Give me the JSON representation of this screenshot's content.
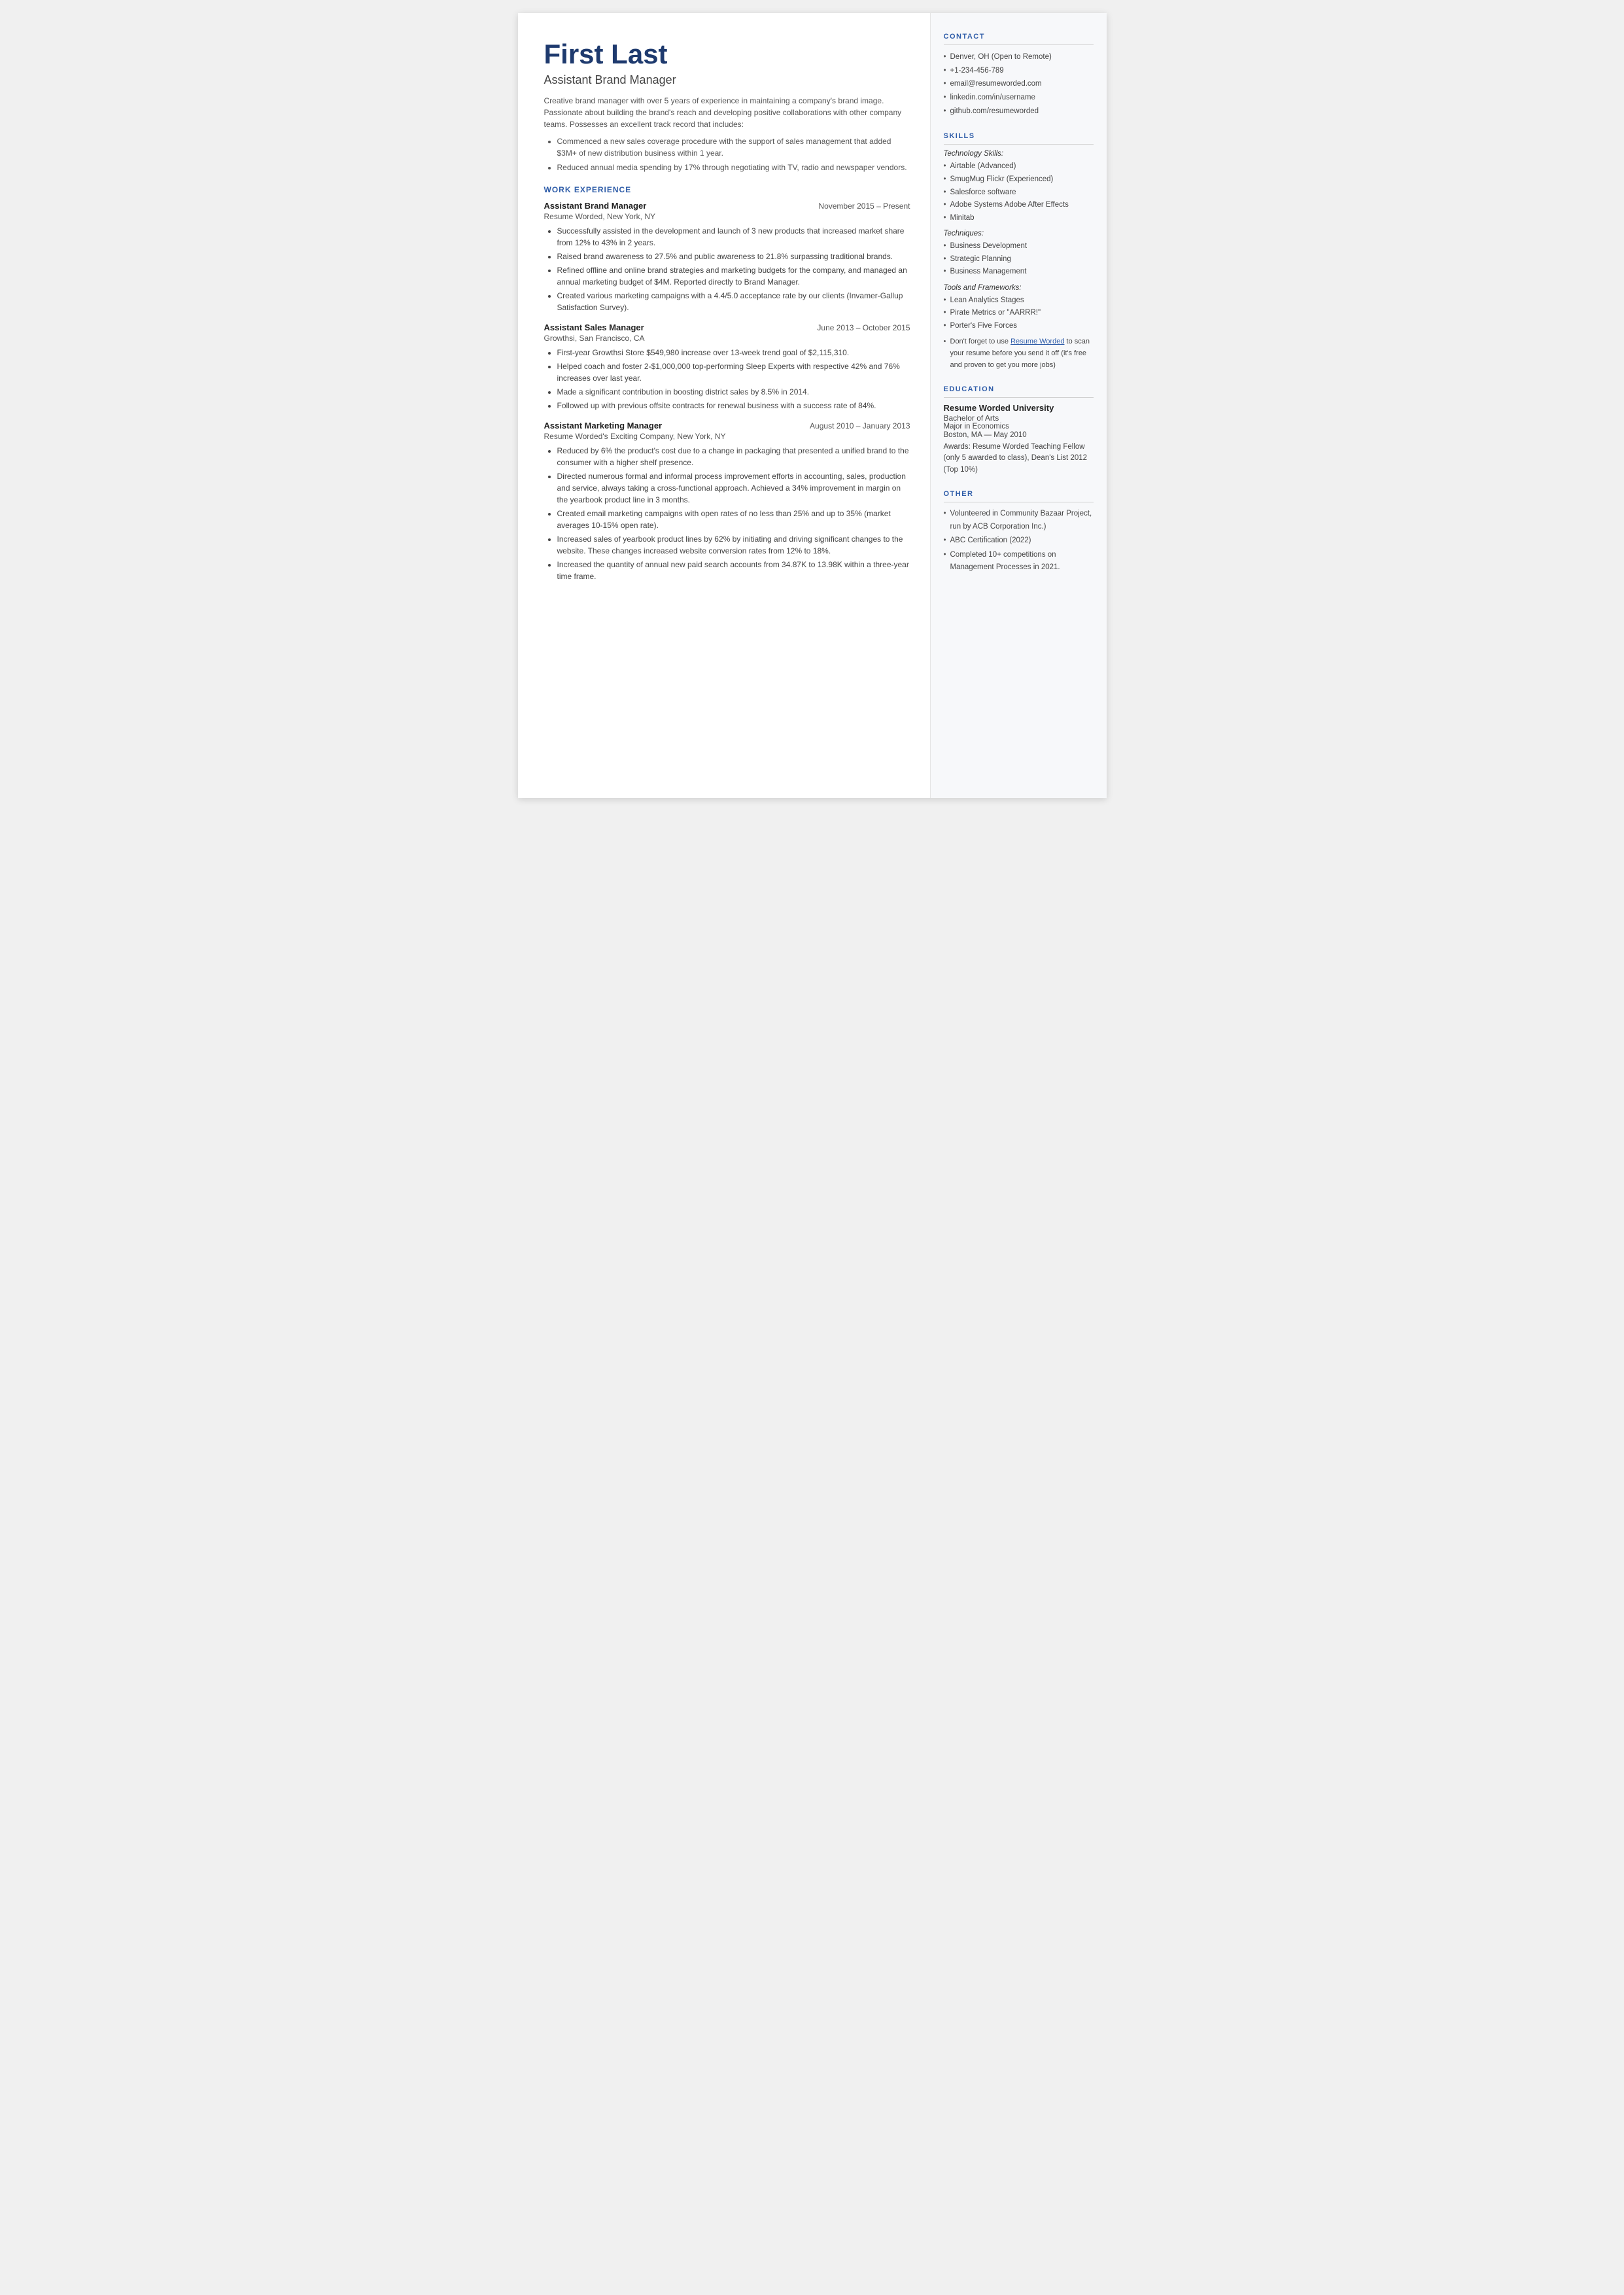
{
  "name": "First Last",
  "job_title": "Assistant Brand Manager",
  "summary": "Creative brand manager with over 5 years of experience in maintaining a company's brand image. Passionate about building the brand's reach and developing positive collaborations with other company teams. Possesses an excellent track record that includes:",
  "summary_bullets": [
    "Commenced a new sales coverage procedure with the support of sales management that added $3M+ of new distribution business within 1 year.",
    "Reduced annual media spending by 17% through negotiating with TV, radio and newspaper vendors."
  ],
  "sections": {
    "work_experience_label": "WORK EXPERIENCE",
    "jobs": [
      {
        "title": "Assistant Brand Manager",
        "dates": "November 2015 – Present",
        "company": "Resume Worded, New York, NY",
        "bullets": [
          "Successfully assisted in the development and launch of 3 new products that increased market share from 12% to 43% in 2 years.",
          "Raised brand awareness to 27.5% and public awareness to 21.8% surpassing traditional brands.",
          "Refined offline and online brand strategies and marketing budgets for the company, and managed an annual marketing budget of $4M. Reported directly to Brand Manager.",
          "Created various marketing campaigns with a 4.4/5.0 acceptance rate by our clients (Invamer-Gallup Satisfaction Survey)."
        ]
      },
      {
        "title": "Assistant Sales Manager",
        "dates": "June 2013 – October 2015",
        "company": "Growthsi, San Francisco, CA",
        "bullets": [
          "First-year Growthsi Store $549,980 increase over 13-week trend goal of $2,115,310.",
          "Helped coach and foster 2-$1,000,000 top-performing Sleep Experts with respective 42% and 76% increases over last year.",
          "Made a significant contribution in boosting district sales by 8.5% in 2014.",
          "Followed up with previous offsite contracts for renewal business with a success rate of 84%."
        ]
      },
      {
        "title": "Assistant Marketing Manager",
        "dates": "August 2010 – January 2013",
        "company": "Resume Worded's Exciting Company, New York, NY",
        "bullets": [
          "Reduced by 6% the product's cost due to a change in packaging that presented a unified brand to the consumer with a higher shelf presence.",
          "Directed numerous formal and informal process improvement efforts in accounting, sales, production and service, always taking a cross-functional approach. Achieved a 34% improvement in margin on the yearbook product line in 3 months.",
          "Created email marketing campaigns with open rates of no less than 25% and up to 35% (market averages 10-15% open rate).",
          "Increased sales of yearbook product lines by 62% by initiating and driving significant changes to the website. These changes increased website conversion rates from 12% to 18%.",
          "Increased the quantity of annual new paid search accounts from 34.87K to 13.98K within a three-year time frame."
        ]
      }
    ]
  },
  "contact": {
    "section_label": "CONTACT",
    "items": [
      "Denver, OH (Open to Remote)",
      "+1-234-456-789",
      "email@resumeworded.com",
      "linkedin.com/in/username",
      "github.com/resumeworded"
    ]
  },
  "skills": {
    "section_label": "SKILLS",
    "technology_label": "Technology Skills:",
    "technology": [
      "Airtable (Advanced)",
      "SmugMug Flickr (Experienced)",
      "Salesforce software",
      "Adobe Systems Adobe After Effects",
      "Minitab"
    ],
    "techniques_label": "Techniques:",
    "techniques": [
      "Business Development",
      "Strategic Planning",
      "Business Management"
    ],
    "tools_label": "Tools and Frameworks:",
    "tools": [
      "Lean Analytics Stages",
      "Pirate Metrics or \"AARRR!\"",
      "Porter's Five Forces"
    ],
    "promo": "Don't forget to use Resume Worded to scan your resume before you send it off (it's free and proven to get you more jobs)"
  },
  "education": {
    "section_label": "EDUCATION",
    "school": "Resume Worded University",
    "degree": "Bachelor of Arts",
    "major": "Major in Economics",
    "location_date": "Boston, MA — May 2010",
    "awards": "Awards: Resume Worded Teaching Fellow (only 5 awarded to class), Dean's List 2012 (Top 10%)"
  },
  "other": {
    "section_label": "OTHER",
    "items": [
      "Volunteered in Community Bazaar Project, run by ACB Corporation Inc.)",
      "ABC Certification (2022)",
      "Completed 10+ competitions on Management Processes in 2021."
    ]
  }
}
